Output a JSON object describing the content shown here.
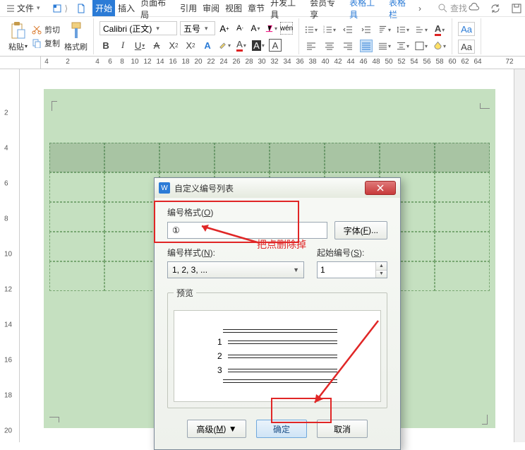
{
  "menubar": {
    "file": "文件",
    "tabs": [
      "开始",
      "插入",
      "页面布局",
      "引用",
      "审阅",
      "视图",
      "章节",
      "开发工具",
      "会员专享",
      "表格工具",
      "表格栏"
    ],
    "search": "查找"
  },
  "ribbon": {
    "paste": "粘贴",
    "cut": "剪切",
    "copy": "复制",
    "format_painter": "格式刷",
    "font_name": "Calibri (正文)",
    "font_size": "五号"
  },
  "ruler": {
    "labels": [
      "4",
      "2",
      "4",
      "6",
      "8",
      "10",
      "12",
      "14",
      "16",
      "18",
      "20",
      "22",
      "24",
      "26",
      "28",
      "30",
      "32",
      "34",
      "36",
      "38",
      "40",
      "42",
      "44",
      "46",
      "48",
      "50",
      "52",
      "54",
      "56",
      "58",
      "60",
      "62",
      "64",
      "72"
    ]
  },
  "vruler": {
    "labels": [
      "2",
      "4",
      "6",
      "8",
      "10",
      "12",
      "14",
      "16",
      "18",
      "20"
    ]
  },
  "dialog": {
    "title": "自定义编号列表",
    "format_label": "编号格式(",
    "format_accel": "O",
    "format_label2": ")",
    "format_value": "①",
    "font_btn": "字体(",
    "font_accel": "F",
    "font_btn2": ")...",
    "style_label": "编号样式(",
    "style_accel": "N",
    "style_label2": "):",
    "style_value": "1, 2, 3, ...",
    "start_label": "起始编号(",
    "start_accel": "S",
    "start_label2": "):",
    "start_value": "1",
    "preview_label": "预览",
    "advanced": "高级(",
    "advanced_accel": "M",
    "advanced2": ") ▼",
    "ok": "确定",
    "cancel": "取消",
    "preview_numbers": [
      "1",
      "2",
      "3"
    ]
  },
  "annotation": {
    "text": "把点删除掉"
  }
}
